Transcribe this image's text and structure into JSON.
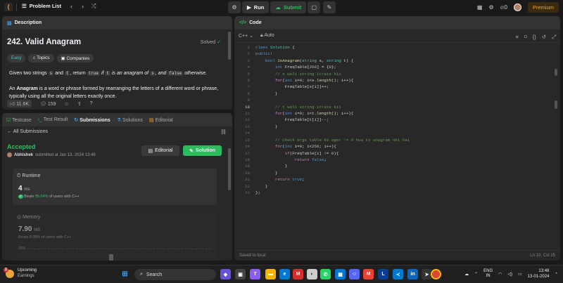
{
  "nav": {
    "problem_list": "Problem List",
    "run": "Run",
    "submit": "Submit",
    "coins": "0",
    "premium": "Premium"
  },
  "description": {
    "tab": "Description",
    "title": "242. Valid Anagram",
    "solved": "Solved",
    "tags": [
      "Easy",
      "Topics",
      "Companies"
    ],
    "p1": [
      "Given two strings",
      "s",
      "and",
      "t",
      ", return",
      "true",
      "if",
      "t",
      "is an anagram of",
      "s",
      ", and",
      "false",
      "otherwise."
    ],
    "p2_bold": "Anagram",
    "p2_a": "An",
    "p2_b": "is a word or phrase formed by rearranging the letters of a different word or phrase, typically using all the original letters exactly once.",
    "likes": "11.6K",
    "comments": "159"
  },
  "subpanel": {
    "tabs": [
      "Testcase",
      "Test Result",
      "Submissions",
      "Solutions",
      "Editorial"
    ],
    "all_submissions": "All Submissions",
    "status": "Accepted",
    "user": "Abhishek",
    "submitted_at": "submitted at Jan 13, 2024 13:48",
    "editorial_btn": "Editorial",
    "solution_btn": "Solution",
    "runtime_label": "Runtime",
    "runtime_value": "4",
    "runtime_unit": "ms",
    "runtime_beats_a": "Beats",
    "runtime_beats_pct": "85.64%",
    "runtime_beats_b": "of users with C++",
    "memory_label": "Memory",
    "memory_value": "7.90",
    "memory_unit": "MB",
    "memory_beats": "Beats 8.08% of users with C++",
    "axis_label": "15%"
  },
  "code": {
    "tab": "Code",
    "language": "C++",
    "auto": "Auto",
    "saved": "Saved to local",
    "cursor": "Ln 10, Col 15",
    "line_numbers": [
      "1",
      "2",
      "3",
      "4",
      "5",
      "6",
      "7",
      "8",
      "9",
      "10",
      "11",
      "12",
      "13",
      "14",
      "15",
      "16",
      "17",
      "18",
      "19",
      "20",
      "21",
      "22",
      "23"
    ]
  },
  "taskbar": {
    "weather_title": "Upcoming",
    "weather_sub": "Earnings",
    "badge": "1",
    "search": "Search",
    "lang": "ENG",
    "region": "IN",
    "time": "13:48",
    "date": "13-01-2024"
  }
}
